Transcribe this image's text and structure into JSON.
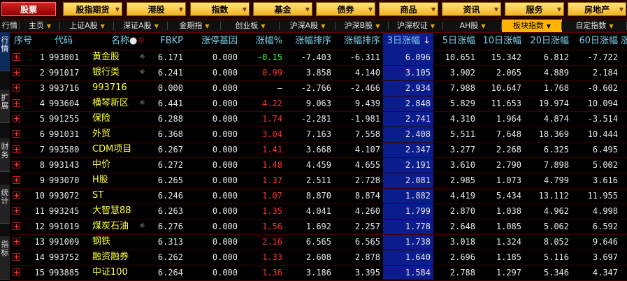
{
  "menu": [
    {
      "label": "股票",
      "active": true
    },
    {
      "label": "股指期货",
      "active": false
    },
    {
      "label": "港股",
      "active": false
    },
    {
      "label": "指数",
      "active": false
    },
    {
      "label": "基金",
      "active": false
    },
    {
      "label": "债券",
      "active": false
    },
    {
      "label": "商品",
      "active": false
    },
    {
      "label": "资讯",
      "active": false
    },
    {
      "label": "服务",
      "active": false
    },
    {
      "label": "房地产",
      "active": false
    }
  ],
  "tabs": [
    {
      "label": "行情",
      "active": false
    },
    {
      "label": "主页",
      "active": false
    },
    {
      "label": "上证A股",
      "active": false
    },
    {
      "label": "深证A股",
      "active": false
    },
    {
      "label": "金期指",
      "active": false
    },
    {
      "label": "创业板",
      "active": false
    },
    {
      "label": "沪深A股",
      "active": false
    },
    {
      "label": "沪深B股",
      "active": false
    },
    {
      "label": "沪深权证",
      "active": false
    },
    {
      "label": "AH股",
      "active": false
    },
    {
      "label": "板块指数",
      "active": true
    },
    {
      "label": "自定指数",
      "active": false
    }
  ],
  "side_tabs": [
    "行情",
    "扩展",
    "财务",
    "统计",
    "指标"
  ],
  "columns": {
    "seq": "序号",
    "code": "代码",
    "name": "名称",
    "fbkp": "FBKP",
    "limit": "涨停基因",
    "pct": "涨幅%",
    "rank1": "涨幅排序",
    "rank2": "涨幅排序",
    "d3": "3日涨幅",
    "d5": "5日涨幅",
    "d10": "10日涨幅",
    "d20": "20日涨幅",
    "d60": "60日涨幅",
    "more": "涨"
  },
  "rows": [
    {
      "seq": "1",
      "code": "993801",
      "name": "黄金股",
      "star": true,
      "fbkp": "6.171",
      "limit": "0.000",
      "pct": "-0.15",
      "pct_color": "green",
      "rank1": "-7.403",
      "rank2": "-6.311",
      "d3": "6.096",
      "d5": "10.651",
      "d10": "15.342",
      "d20": "6.812",
      "d60": "-7.722"
    },
    {
      "seq": "2",
      "code": "991017",
      "name": "银行类",
      "star": true,
      "fbkp": "6.241",
      "limit": "0.000",
      "pct": "0.99",
      "pct_color": "red",
      "rank1": "3.858",
      "rank2": "4.140",
      "d3": "3.105",
      "d5": "3.902",
      "d10": "2.065",
      "d20": "4.889",
      "d60": "2.184"
    },
    {
      "seq": "3",
      "code": "993716",
      "name": "993716",
      "star": false,
      "fbkp": "0.000",
      "limit": "0.000",
      "pct": "—",
      "pct_color": "white",
      "rank1": "-2.766",
      "rank2": "-2.466",
      "d3": "2.934",
      "d5": "7.988",
      "d10": "10.647",
      "d20": "1.768",
      "d60": "-0.602"
    },
    {
      "seq": "4",
      "code": "993604",
      "name": "横琴新区",
      "star": true,
      "fbkp": "6.441",
      "limit": "0.000",
      "pct": "4.22",
      "pct_color": "red",
      "rank1": "9.063",
      "rank2": "9.439",
      "d3": "2.848",
      "d5": "5.829",
      "d10": "11.653",
      "d20": "19.974",
      "d60": "10.094"
    },
    {
      "seq": "5",
      "code": "991255",
      "name": "保险",
      "star": false,
      "fbkp": "6.288",
      "limit": "0.000",
      "pct": "1.74",
      "pct_color": "red",
      "rank1": "-2.281",
      "rank2": "-1.981",
      "d3": "2.741",
      "d5": "4.310",
      "d10": "1.964",
      "d20": "4.874",
      "d60": "-3.514"
    },
    {
      "seq": "6",
      "code": "991031",
      "name": "外贸",
      "star": false,
      "fbkp": "6.368",
      "limit": "0.000",
      "pct": "3.04",
      "pct_color": "red",
      "rank1": "7.163",
      "rank2": "7.558",
      "d3": "2.408",
      "d5": "5.511",
      "d10": "7.648",
      "d20": "18.369",
      "d60": "10.444"
    },
    {
      "seq": "7",
      "code": "993580",
      "name": "CDM项目",
      "star": false,
      "fbkp": "6.267",
      "limit": "0.000",
      "pct": "1.41",
      "pct_color": "red",
      "rank1": "3.668",
      "rank2": "4.107",
      "d3": "2.347",
      "d5": "3.277",
      "d10": "2.268",
      "d20": "6.325",
      "d60": "6.495"
    },
    {
      "seq": "8",
      "code": "993143",
      "name": "中价",
      "star": false,
      "fbkp": "6.272",
      "limit": "0.000",
      "pct": "1.48",
      "pct_color": "red",
      "rank1": "4.459",
      "rank2": "4.655",
      "d3": "2.191",
      "d5": "3.610",
      "d10": "2.790",
      "d20": "7.898",
      "d60": "5.002"
    },
    {
      "seq": "9",
      "code": "993070",
      "name": "H股",
      "star": false,
      "fbkp": "6.265",
      "limit": "0.000",
      "pct": "1.37",
      "pct_color": "red",
      "rank1": "2.511",
      "rank2": "2.728",
      "d3": "2.081",
      "d5": "2.985",
      "d10": "1.073",
      "d20": "4.799",
      "d60": "3.616"
    },
    {
      "seq": "10",
      "code": "993072",
      "name": "ST",
      "star": false,
      "fbkp": "6.246",
      "limit": "0.000",
      "pct": "1.07",
      "pct_color": "red",
      "rank1": "8.870",
      "rank2": "8.874",
      "d3": "1.882",
      "d5": "4.419",
      "d10": "5.434",
      "d20": "13.112",
      "d60": "11.955"
    },
    {
      "seq": "11",
      "code": "993245",
      "name": "大智慧88",
      "star": false,
      "fbkp": "6.263",
      "limit": "0.000",
      "pct": "1.35",
      "pct_color": "red",
      "rank1": "4.041",
      "rank2": "4.260",
      "d3": "1.799",
      "d5": "2.870",
      "d10": "1.038",
      "d20": "4.962",
      "d60": "4.998"
    },
    {
      "seq": "12",
      "code": "991019",
      "name": "煤炭石油",
      "star": true,
      "fbkp": "6.276",
      "limit": "0.000",
      "pct": "1.56",
      "pct_color": "red",
      "rank1": "1.692",
      "rank2": "2.257",
      "d3": "1.778",
      "d5": "2.648",
      "d10": "1.085",
      "d20": "5.062",
      "d60": "6.592"
    },
    {
      "seq": "13",
      "code": "991009",
      "name": "钢铁",
      "star": false,
      "fbkp": "6.313",
      "limit": "0.000",
      "pct": "2.16",
      "pct_color": "red",
      "rank1": "6.565",
      "rank2": "6.565",
      "d3": "1.738",
      "d5": "3.018",
      "d10": "1.324",
      "d20": "8.052",
      "d60": "9.646"
    },
    {
      "seq": "14",
      "code": "993752",
      "name": "融资融券",
      "star": false,
      "fbkp": "6.262",
      "limit": "0.000",
      "pct": "1.33",
      "pct_color": "red",
      "rank1": "2.608",
      "rank2": "2.878",
      "d3": "1.640",
      "d5": "2.696",
      "d10": "1.185",
      "d20": "5.116",
      "d60": "3.697"
    },
    {
      "seq": "15",
      "code": "993885",
      "name": "中证100",
      "star": false,
      "fbkp": "6.264",
      "limit": "0.000",
      "pct": "1.36",
      "pct_color": "red",
      "rank1": "3.186",
      "rank2": "3.395",
      "d3": "1.584",
      "d5": "2.788",
      "d10": "1.297",
      "d20": "5.346",
      "d60": "4.347"
    }
  ],
  "colors": {
    "accent": "#ffb400",
    "selected_column": "#0b1c8c",
    "up": "#ff3333",
    "down": "#33ff33",
    "name": "#ffff3c",
    "header": "#79d0e8"
  },
  "icons": {
    "expand": "plus-box-icon",
    "star": "star-icon",
    "sort": "sort-desc-arrow-icon",
    "dropdown": "dropdown-triangle-icon"
  }
}
